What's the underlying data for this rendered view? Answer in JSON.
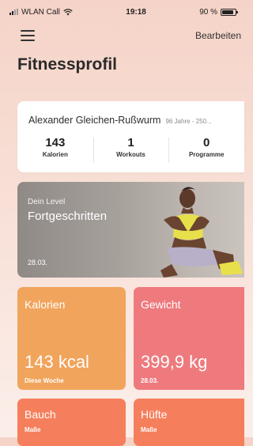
{
  "status_bar": {
    "carrier": "WLAN Call",
    "time": "19:18",
    "battery": "90 %",
    "battery_level": 0.9
  },
  "nav": {
    "menu_icon": "hamburger-menu-icon",
    "edit_label": "Bearbeiten"
  },
  "page": {
    "title": "Fitnessprofil"
  },
  "profile": {
    "name": "Alexander Gleichen-Rußwurm",
    "age_info": "96 Jahre - 250...",
    "stats": [
      {
        "value": "143",
        "label": "Kalorien"
      },
      {
        "value": "1",
        "label": "Workouts"
      },
      {
        "value": "0",
        "label": "Programme"
      }
    ]
  },
  "level": {
    "subtitle": "Dein Level",
    "title": "Fortgeschritten",
    "date": "28.03."
  },
  "tiles": [
    {
      "title": "Kalorien",
      "value": "143 kcal",
      "subtitle": "Diese Woche",
      "color": "#f1a45c"
    },
    {
      "title": "Gewicht",
      "value": "399,9 kg",
      "subtitle": "28.03.",
      "color": "#ee7a7e"
    },
    {
      "title": "Bauch",
      "subtitle": "Maße",
      "color": "#f57f5c"
    },
    {
      "title": "Hüfte",
      "subtitle": "Maße",
      "color": "#f57f5c"
    }
  ]
}
